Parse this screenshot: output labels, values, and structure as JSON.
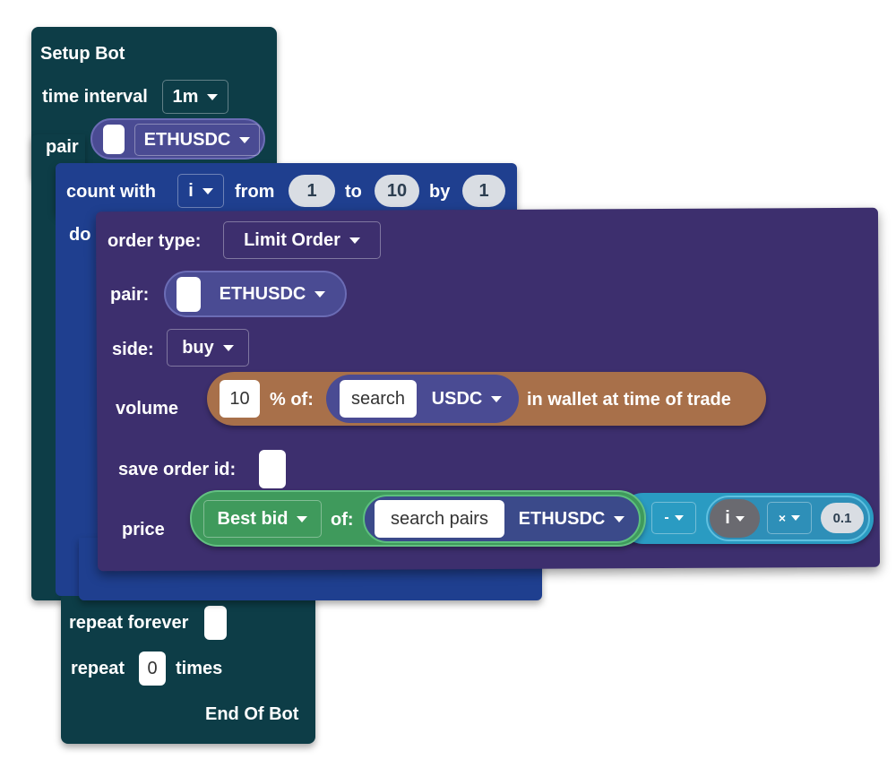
{
  "setup_bot": {
    "title": "Setup Bot",
    "time_interval_label": "time interval",
    "time_interval_value": "1m",
    "pair_label": "pair",
    "pair_value": "ETHUSDC",
    "repeat_forever_label": "repeat forever",
    "repeat_label": "repeat",
    "repeat_count": "0",
    "times_label": "times",
    "end_label": "End Of Bot"
  },
  "count_with": {
    "label": "count with",
    "var": "i",
    "from_label": "from",
    "from_value": "1",
    "to_label": "to",
    "to_value": "10",
    "by_label": "by",
    "by_value": "1",
    "do_label": "do"
  },
  "order": {
    "type_label": "order type:",
    "type_value": "Limit Order",
    "pair_label": "pair:",
    "pair_value": "ETHUSDC",
    "side_label": "side:",
    "side_value": "buy",
    "volume_label": "volume",
    "volume_value": "10",
    "percent_of_label": "% of:",
    "search_label": "search",
    "currency_value": "USDC",
    "wallet_text": "in wallet at time of trade",
    "save_order_label": "save order id:",
    "price_label": "price",
    "best_bid_value": "Best bid",
    "of_label": "of:",
    "search_pairs_label": "search pairs",
    "price_pair_value": "ETHUSDC",
    "minus_op": "-",
    "var_i": "i",
    "times_op": "×",
    "multiplier_value": "0.1"
  },
  "colors": {
    "setup_bg": "#0d3d47",
    "count_bg": "#1f3f8f",
    "order_bg": "#3d2f6e",
    "pair_pill_bg": "#4a4b93",
    "volume_bg": "#a8704a",
    "price_green": "#3f9a5c",
    "price_cyan": "#2a9bc2"
  }
}
